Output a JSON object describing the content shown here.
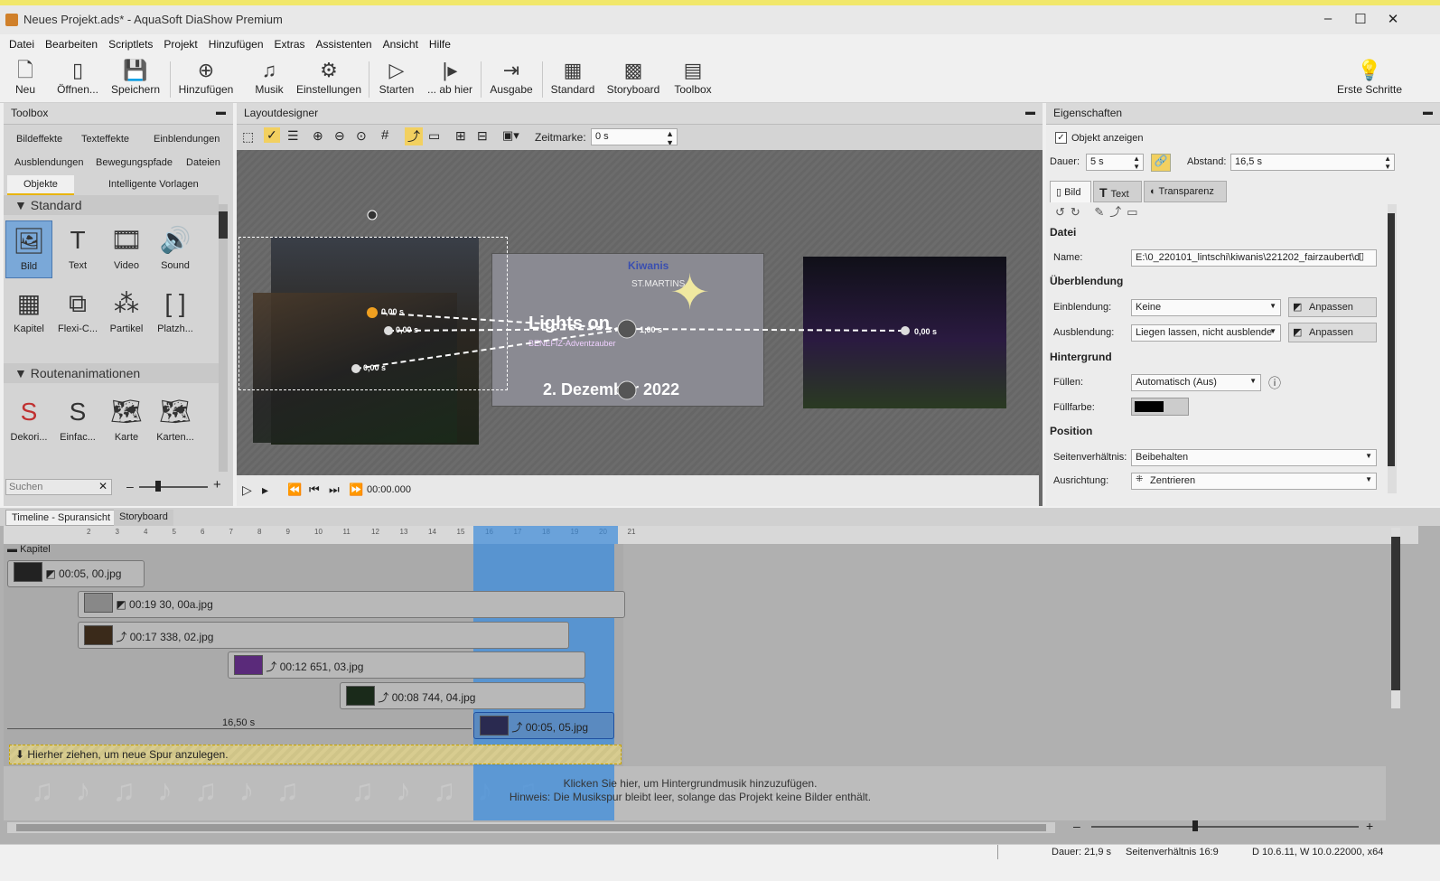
{
  "window": {
    "title": "Neues Projekt.ads* - AquaSoft DiaShow Premium"
  },
  "menu": [
    "Datei",
    "Bearbeiten",
    "Scriptlets",
    "Projekt",
    "Hinzufügen",
    "Extras",
    "Assistenten",
    "Ansicht",
    "Hilfe"
  ],
  "toolbar": {
    "neu": "Neu",
    "oeffnen": "Öffnen...",
    "speichern": "Speichern",
    "hinzufuegen": "Hinzufügen",
    "musik": "Musik",
    "einstellungen": "Einstellungen",
    "starten": "Starten",
    "abhier": "... ab hier",
    "ausgabe": "Ausgabe",
    "standard": "Standard",
    "storyboard": "Storyboard",
    "toolbox": "Toolbox",
    "ersteschritte": "Erste Schritte"
  },
  "toolbox": {
    "title": "Toolbox",
    "tabs": [
      "Bildeffekte",
      "Texteffekte",
      "Einblendungen",
      "Ausblendungen",
      "Bewegungspfade",
      "Dateien",
      "Objekte",
      "Intelligente Vorlagen"
    ],
    "section_standard": "Standard",
    "standard_items": [
      "Bild",
      "Text",
      "Video",
      "Sound",
      "Kapitel",
      "Flexi-C...",
      "Partikel",
      "Platzh..."
    ],
    "section_routen": "Routenanimationen",
    "routen_items": [
      "Dekori...",
      "Einfac...",
      "Karte",
      "Karten..."
    ],
    "search_placeholder": "Suchen"
  },
  "layout": {
    "title": "Layoutdesigner",
    "zeitmarke_label": "Zeitmarke:",
    "zeitmarke_value": "0 s",
    "time_display": "00:00.000",
    "markers": [
      "0,00 s",
      "0,00 s",
      "0,00 s",
      "1,00 s",
      "0,00 s"
    ],
    "slide_title": "Lights on",
    "slide_sub": "BENEFIZ-Adventzauber",
    "slide_date": "2. Dezember 2022",
    "logo1": "Kiwanis",
    "logo2": "ST.MARTINS"
  },
  "props": {
    "title": "Eigenschaften",
    "show_object": "Objekt anzeigen",
    "dauer_label": "Dauer:",
    "dauer_value": "5 s",
    "abstand_label": "Abstand:",
    "abstand_value": "16,5 s",
    "tabs": [
      "Bild",
      "Text",
      "Transparenz"
    ],
    "sec_datei": "Datei",
    "name_label": "Name:",
    "name_value": "E:\\0_220101_lintschi\\kiwanis\\221202_fairzaubert\\d",
    "sec_ueber": "Überblendung",
    "einbl_label": "Einblendung:",
    "einbl_value": "Keine",
    "ausbl_label": "Ausblendung:",
    "ausbl_value": "Liegen lassen, nicht ausblende",
    "anpassen": "Anpassen",
    "sec_hinter": "Hintergrund",
    "fuellen_label": "Füllen:",
    "fuellen_value": "Automatisch (Aus)",
    "fuellfarbe_label": "Füllfarbe:",
    "sec_pos": "Position",
    "seiten_label": "Seitenverhältnis:",
    "seiten_value": "Beibehalten",
    "ausr_label": "Ausrichtung:",
    "ausr_value": "Zentrieren"
  },
  "timeline": {
    "tabs": [
      "Timeline - Spuransicht",
      "Storyboard"
    ],
    "kapitel": "Kapitel",
    "tracks": [
      "00:05, 00.jpg",
      "00:19 30, 00a.jpg",
      "00:17 338, 02.jpg",
      "00:12 651, 03.jpg",
      "00:08 744, 04.jpg",
      "00:05, 05.jpg"
    ],
    "distance": "16,50 s",
    "drop_hint": "Hierher ziehen, um neue Spur anzulegen.",
    "music_hint1": "Klicken Sie hier, um Hintergrundmusik hinzuzufügen.",
    "music_hint2": "Hinweis: Die Musikspur bleibt leer, solange das Projekt keine Bilder enthält.",
    "ruler": [
      "2",
      "3",
      "4",
      "5",
      "6",
      "7",
      "8",
      "9",
      "10",
      "11",
      "12",
      "13",
      "14",
      "15",
      "16",
      "17",
      "18",
      "19",
      "20",
      "21"
    ]
  },
  "status": {
    "dauer": "Dauer: 21,9 s",
    "seiten": "Seitenverhältnis 16:9",
    "version": "D 10.6.11, W 10.0.22000, x64"
  }
}
